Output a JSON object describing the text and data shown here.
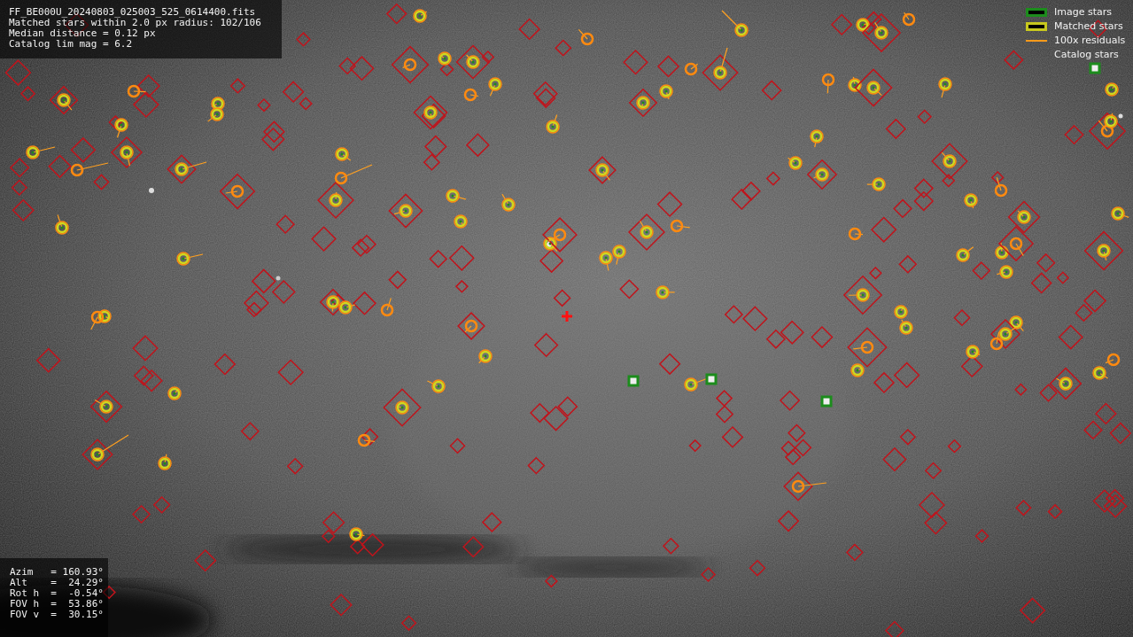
{
  "info": {
    "lines": [
      "FF_BE000U_20240803_025003_525_0614400.fits",
      "Matched stars within 2.0 px radius: 102/106",
      "Median distance = 0.12 px",
      "Catalog lim mag = 6.2"
    ]
  },
  "legend": [
    {
      "label": "Image stars",
      "kind": "box",
      "color": "#1c8c1c"
    },
    {
      "label": "Matched stars",
      "kind": "box",
      "color": "#c8c81e"
    },
    {
      "label": "100x residuals",
      "kind": "line",
      "color": "#ff9a1a"
    },
    {
      "label": "Catalog stars",
      "kind": "none"
    }
  ],
  "pointing": {
    "lines": [
      "Azim   = 160.93°",
      "Alt    =  24.29°",
      "Rot h  =  -0.54°",
      "FOV h  =  53.86°",
      "FOV v  =  30.15°"
    ]
  }
}
